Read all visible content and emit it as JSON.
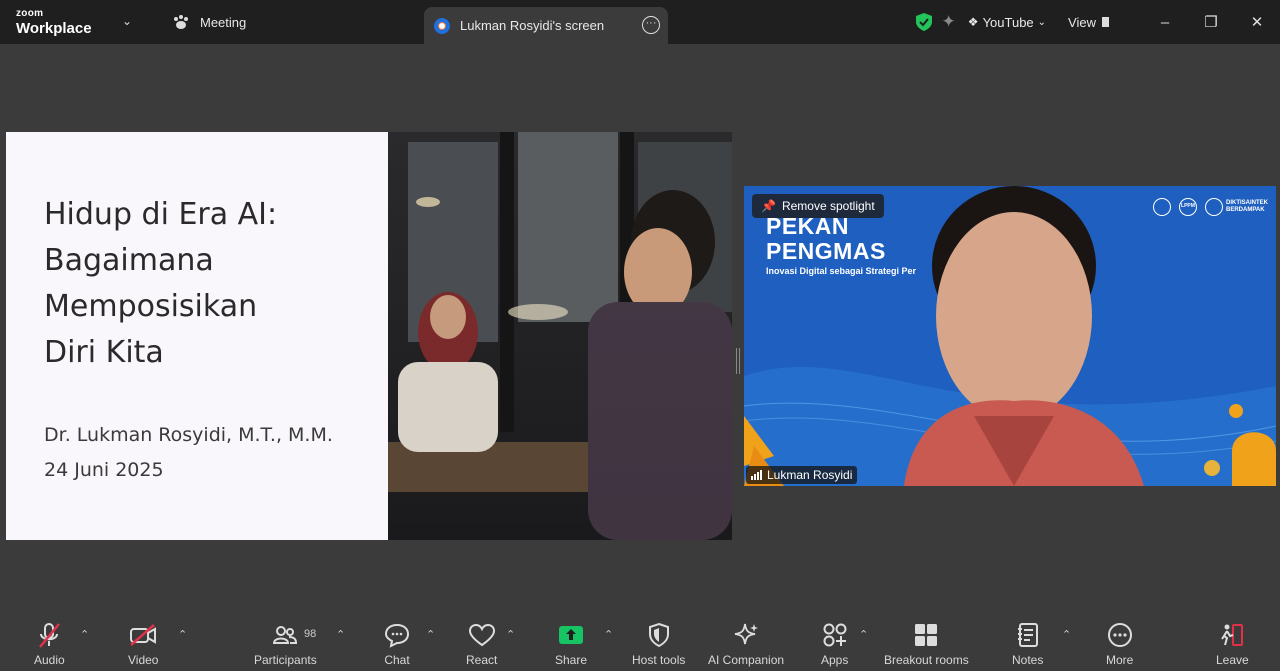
{
  "titlebar": {
    "brand_top": "zoom",
    "brand_bottom": "Workplace",
    "meeting_tab": "Meeting",
    "screen_tab": "Lukman Rosyidi's screen",
    "youtube_label": "YouTube",
    "view_label": "View"
  },
  "slide": {
    "title_line1": "Hidup di Era AI:",
    "title_line2": "Bagaimana",
    "title_line3": "Memposisikan",
    "title_line4": "Diri Kita",
    "author": "Dr. Lukman Rosyidi, M.T., M.M.",
    "date": "24 Juni 2025"
  },
  "video": {
    "remove_spotlight": "Remove spotlight",
    "bg_title_line1": "PEKAN",
    "bg_title_line2": "PENGMAS",
    "bg_subtitle": "Inovasi Digital sebagai Strategi Per",
    "logo_text_1": "LPPM",
    "logo_text_2": "DIKTISAINTEK",
    "logo_text_3": "BERDAMPAK",
    "participant_name": "Lukman Rosyidi"
  },
  "toolbar": {
    "audio": "Audio",
    "video": "Video",
    "participants": "Participants",
    "participants_count": "98",
    "chat": "Chat",
    "react": "React",
    "share": "Share",
    "host_tools": "Host tools",
    "ai_companion": "AI Companion",
    "apps": "Apps",
    "breakout_rooms": "Breakout rooms",
    "notes": "Notes",
    "more": "More",
    "leave": "Leave"
  },
  "colors": {
    "share_green": "#17c464",
    "muted_red": "#e0314a",
    "security_green": "#23c45a",
    "video_bg_blue": "#1e5fbf"
  }
}
